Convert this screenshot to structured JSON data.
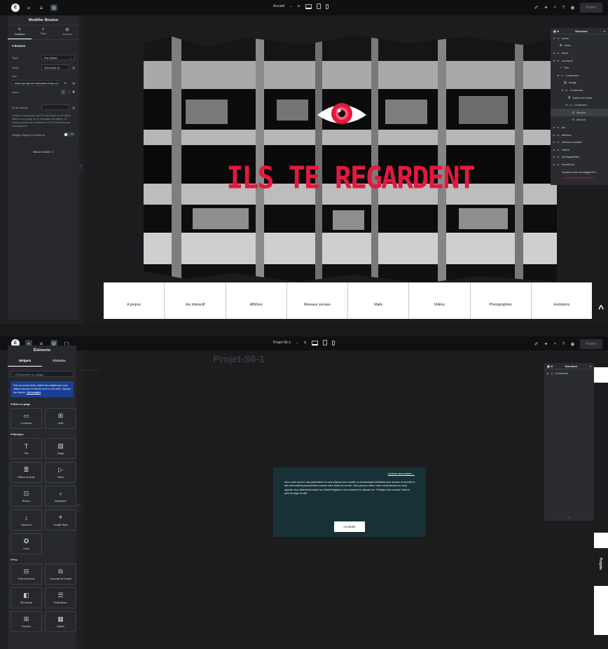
{
  "shotA": {
    "topbar": {
      "page_select": "Accueil",
      "publish": "Publier"
    },
    "panel": {
      "title": "Modifier Bouton",
      "tabs": [
        "Contenu",
        "Style",
        "Avancé"
      ],
      "section": "Bouton",
      "type_label": "Type",
      "type_value": "Par défaut",
      "text_label": "Texte",
      "text_value": "Découvrir ici",
      "link_label": "Lien",
      "link_value": "https://projet-s6.mbaufoss.fr/wp-conte",
      "icon_label": "Icône",
      "id_label": "ID du bouton",
      "id_note": "Veuillez vous assurer que l'ID est unique et non utilisé ailleurs sur la page où ce formulaire est affiché. Ce champ autorise les caractères A-z 0-9 et les tirets bas sans espaces.",
      "cta_label": "Widget d'appel à l'action",
      "toggle": "Off",
      "help": "Besoin d'aide"
    },
    "hero_title": "ILS TE REGARDENT",
    "menu": [
      "A propos",
      "Jeu interactif",
      "Affiches",
      "Réseaux sociaux",
      "Mails",
      "Vidéos",
      "Photographies",
      "Evolutions"
    ],
    "structure": {
      "title": "Structure",
      "rows": [
        {
          "label": "arrow",
          "depth": 0,
          "kind": "container"
        },
        {
          "label": "Icône",
          "depth": 1,
          "kind": "icon"
        },
        {
          "label": "head",
          "depth": 0,
          "kind": "container"
        },
        {
          "label": "a-propos",
          "depth": 0,
          "kind": "container"
        },
        {
          "label": "Titre",
          "depth": 1,
          "kind": "title"
        },
        {
          "label": "Conteneur",
          "depth": 1,
          "kind": "container"
        },
        {
          "label": "Image",
          "depth": 2,
          "kind": "image"
        },
        {
          "label": "Conteneur",
          "depth": 2,
          "kind": "container"
        },
        {
          "label": "Éditeur de texte",
          "depth": 3,
          "kind": "text"
        },
        {
          "label": "Conteneur",
          "depth": 3,
          "kind": "container"
        },
        {
          "label": "Bouton",
          "depth": 4,
          "kind": "button"
        },
        {
          "label": "Bouton",
          "depth": 4,
          "kind": "button"
        },
        {
          "label": "jeu",
          "depth": 0,
          "kind": "container"
        },
        {
          "label": "affiches",
          "depth": 0,
          "kind": "container"
        },
        {
          "label": "reseaux-sociaux",
          "depth": 0,
          "kind": "container"
        },
        {
          "label": "videos",
          "depth": 0,
          "kind": "container"
        },
        {
          "label": "photographies",
          "depth": 0,
          "kind": "container"
        },
        {
          "label": "evolutions",
          "depth": 0,
          "kind": "container"
        }
      ],
      "selected_index": 10,
      "footer": "Accéder à tous les widgets Pro.",
      "footer_link": "Mettre à niveau maintenant"
    }
  },
  "shotB": {
    "topbar": {
      "page_select": "Projet-S6-1",
      "publish": "Publier"
    },
    "widgets": {
      "tabs": [
        "Widgets",
        "Globales"
      ],
      "search_placeholder": "Rechercher un widget",
      "promo": "Pour un accès facile, mettez les widgets que vous utilisez souvent en favoris avec un clic droit > Ajouter aux favoris.",
      "promo_cta": "J'ai compris",
      "sections": [
        {
          "title": "Mise en page",
          "items": [
            {
              "label": "Conteneur",
              "glyph": "▭"
            },
            {
              "label": "Grille",
              "glyph": "⊞"
            }
          ]
        },
        {
          "title": "Basique",
          "items": [
            {
              "label": "Titre",
              "glyph": "T"
            },
            {
              "label": "Image",
              "glyph": "▨"
            },
            {
              "label": "Éditeur de texte",
              "glyph": "≣"
            },
            {
              "label": "Vidéo",
              "glyph": "▷"
            },
            {
              "label": "Bouton",
              "glyph": "⊡"
            },
            {
              "label": "Séparateur",
              "glyph": "÷"
            },
            {
              "label": "Espaceur",
              "glyph": "↕"
            },
            {
              "label": "Google Maps",
              "glyph": "⌖"
            },
            {
              "label": "Icône",
              "glyph": "✪"
            }
          ]
        },
        {
          "title": "Pro",
          "items": [
            {
              "label": "Grille de boucle",
              "glyph": "⊟"
            },
            {
              "label": "Carrousel de boucle",
              "glyph": "⧉"
            },
            {
              "label": "Off-Canvas",
              "glyph": "◧"
            },
            {
              "label": "Publications",
              "glyph": "☰"
            },
            {
              "label": "Portfolio",
              "glyph": "⊞"
            },
            {
              "label": "Galerie",
              "glyph": "▦"
            }
          ]
        }
      ]
    },
    "page_title": "Projet-S6-1",
    "page_hint": "Texte de contenu",
    "cookie": {
      "link": "Continuer sans accepter →",
      "text": "Avec votre accord, nos partenaires et nous utilisons des cookies ou technologies similaires pour stocker et accéder à des informations personnelles comme votre visite sur ce site. Vous pouvez retirer votre consentement ou vous opposer aux traitements basés sur l'intérêt légitime à tout moment en cliquant sur \"Politique des cookies\" dans le pied de page du site.",
      "accept": "Accepter"
    },
    "structure": {
      "title": "Structure",
      "rows": [
        {
          "label": "Conteneur"
        }
      ]
    },
    "side_text": "Projets"
  },
  "colors": {
    "accent_red": "#e3193e",
    "cookie_bg": "#173137",
    "promo_blue": "#1a3f94"
  }
}
